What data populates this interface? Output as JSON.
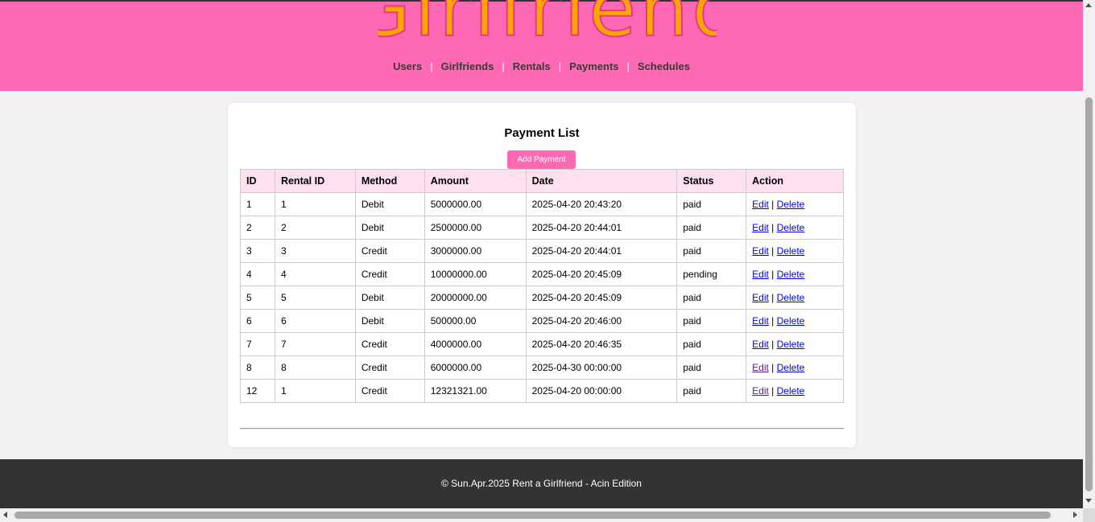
{
  "header": {
    "logo_text": "Girlfriend",
    "nav": [
      {
        "label": "Users"
      },
      {
        "label": "Girlfriends"
      },
      {
        "label": "Rentals"
      },
      {
        "label": "Payments"
      },
      {
        "label": "Schedules"
      }
    ],
    "separator": "|"
  },
  "main": {
    "title": "Payment List",
    "add_button_label": "Add Payment",
    "table": {
      "columns": [
        "ID",
        "Rental ID",
        "Method",
        "Amount",
        "Date",
        "Status",
        "Action"
      ],
      "rows": [
        {
          "id": "1",
          "rental_id": "1",
          "method": "Debit",
          "amount": "5000000.00",
          "date": "2025-04-20 20:43:20",
          "status": "paid"
        },
        {
          "id": "2",
          "rental_id": "2",
          "method": "Debit",
          "amount": "2500000.00",
          "date": "2025-04-20 20:44:01",
          "status": "paid"
        },
        {
          "id": "3",
          "rental_id": "3",
          "method": "Credit",
          "amount": "3000000.00",
          "date": "2025-04-20 20:44:01",
          "status": "paid"
        },
        {
          "id": "4",
          "rental_id": "4",
          "method": "Credit",
          "amount": "10000000.00",
          "date": "2025-04-20 20:45:09",
          "status": "pending"
        },
        {
          "id": "5",
          "rental_id": "5",
          "method": "Debit",
          "amount": "20000000.00",
          "date": "2025-04-20 20:45:09",
          "status": "paid"
        },
        {
          "id": "6",
          "rental_id": "6",
          "method": "Debit",
          "amount": "500000.00",
          "date": "2025-04-20 20:46:00",
          "status": "paid"
        },
        {
          "id": "7",
          "rental_id": "7",
          "method": "Credit",
          "amount": "4000000.00",
          "date": "2025-04-20 20:46:35",
          "status": "paid"
        },
        {
          "id": "8",
          "rental_id": "8",
          "method": "Credit",
          "amount": "6000000.00",
          "date": "2025-04-30 00:00:00",
          "status": "paid"
        },
        {
          "id": "12",
          "rental_id": "1",
          "method": "Credit",
          "amount": "12321321.00",
          "date": "2025-04-20 00:00:00",
          "status": "paid"
        }
      ],
      "edit_label": "Edit",
      "delete_label": "Delete",
      "action_separator": "|"
    }
  },
  "footer": {
    "text": "© Sun.Apr.2025 Rent a Girlfriend - Acin Edition"
  },
  "colors": {
    "header_bg": "#ff69b4",
    "table_header_bg": "#ffe0ef",
    "footer_bg": "#333333",
    "page_bg": "#f2f2f2"
  }
}
